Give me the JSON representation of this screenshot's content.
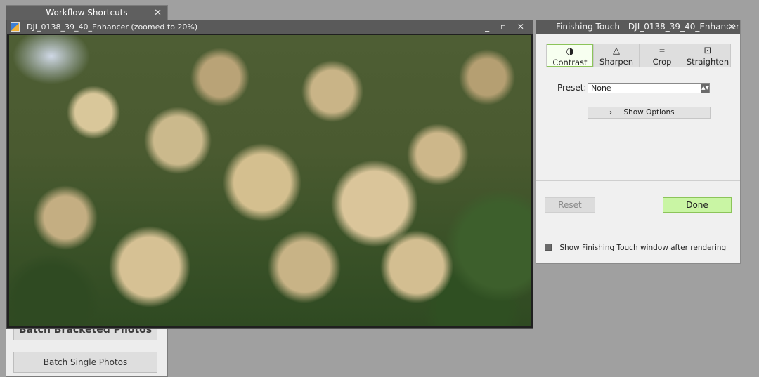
{
  "shortcuts": {
    "title": "Workflow Shortcuts",
    "close": "✕",
    "buttons": [
      "Batch Bracketed Photos",
      "Batch Single Photos"
    ]
  },
  "viewer": {
    "title": "DJI_0138_39_40_Enhancer (zoomed to 20%)",
    "controls": "_ ▫ ✕",
    "zoom_percent": 20
  },
  "finishing": {
    "title": "Finishing Touch - DJI_0138_39_40_Enhancer",
    "close": "✕",
    "tabs": [
      {
        "icon": "◑",
        "label": "Contrast"
      },
      {
        "icon": "△",
        "label": "Sharpen"
      },
      {
        "icon": "⌗",
        "label": "Crop"
      },
      {
        "icon": "⊡",
        "label": "Straighten"
      }
    ],
    "active_tab": "Contrast",
    "preset_label": "Preset:",
    "preset_value": "None",
    "show_options": "Show Options",
    "reset": "Reset",
    "done": "Done",
    "checkbox_label": "Show Finishing Touch window after rendering",
    "checkbox_checked": true
  },
  "colors": {
    "accent_green": "#c9f5a4",
    "titlebar": "#5a5a5a"
  }
}
